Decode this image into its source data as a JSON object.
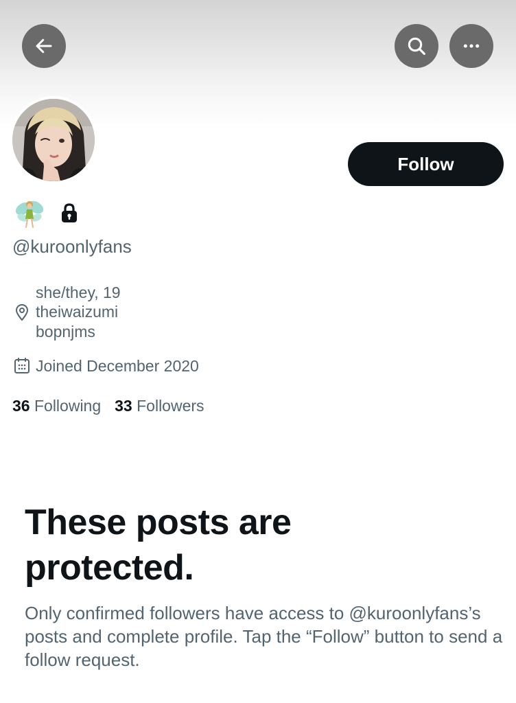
{
  "header": {
    "back_icon": "arrow-left-icon",
    "search_icon": "search-icon",
    "more_icon": "more-horizontal-icon"
  },
  "profile": {
    "emoji_icon": "fairy-emoji-icon",
    "protected_icon": "lock-icon",
    "handle": "@kuroonlyfans",
    "bio_lines": [
      "she/they, 19",
      "theiwaizumi",
      "bopnjms"
    ],
    "joined": "Joined December 2020",
    "following_count": "36",
    "following_label": "Following",
    "followers_count": "33",
    "followers_label": "Followers"
  },
  "follow_button": {
    "label": "Follow",
    "background": "#0f1419"
  },
  "protected_notice": {
    "title": "These posts are protected.",
    "description": "Only confirmed followers have access to @kuroonlyfans’s posts and complete profile. Tap the “Follow” button to send a follow request."
  },
  "colors": {
    "primary_text": "#0f1419",
    "secondary_text": "#536471",
    "header_button": "#6a6a6a"
  }
}
